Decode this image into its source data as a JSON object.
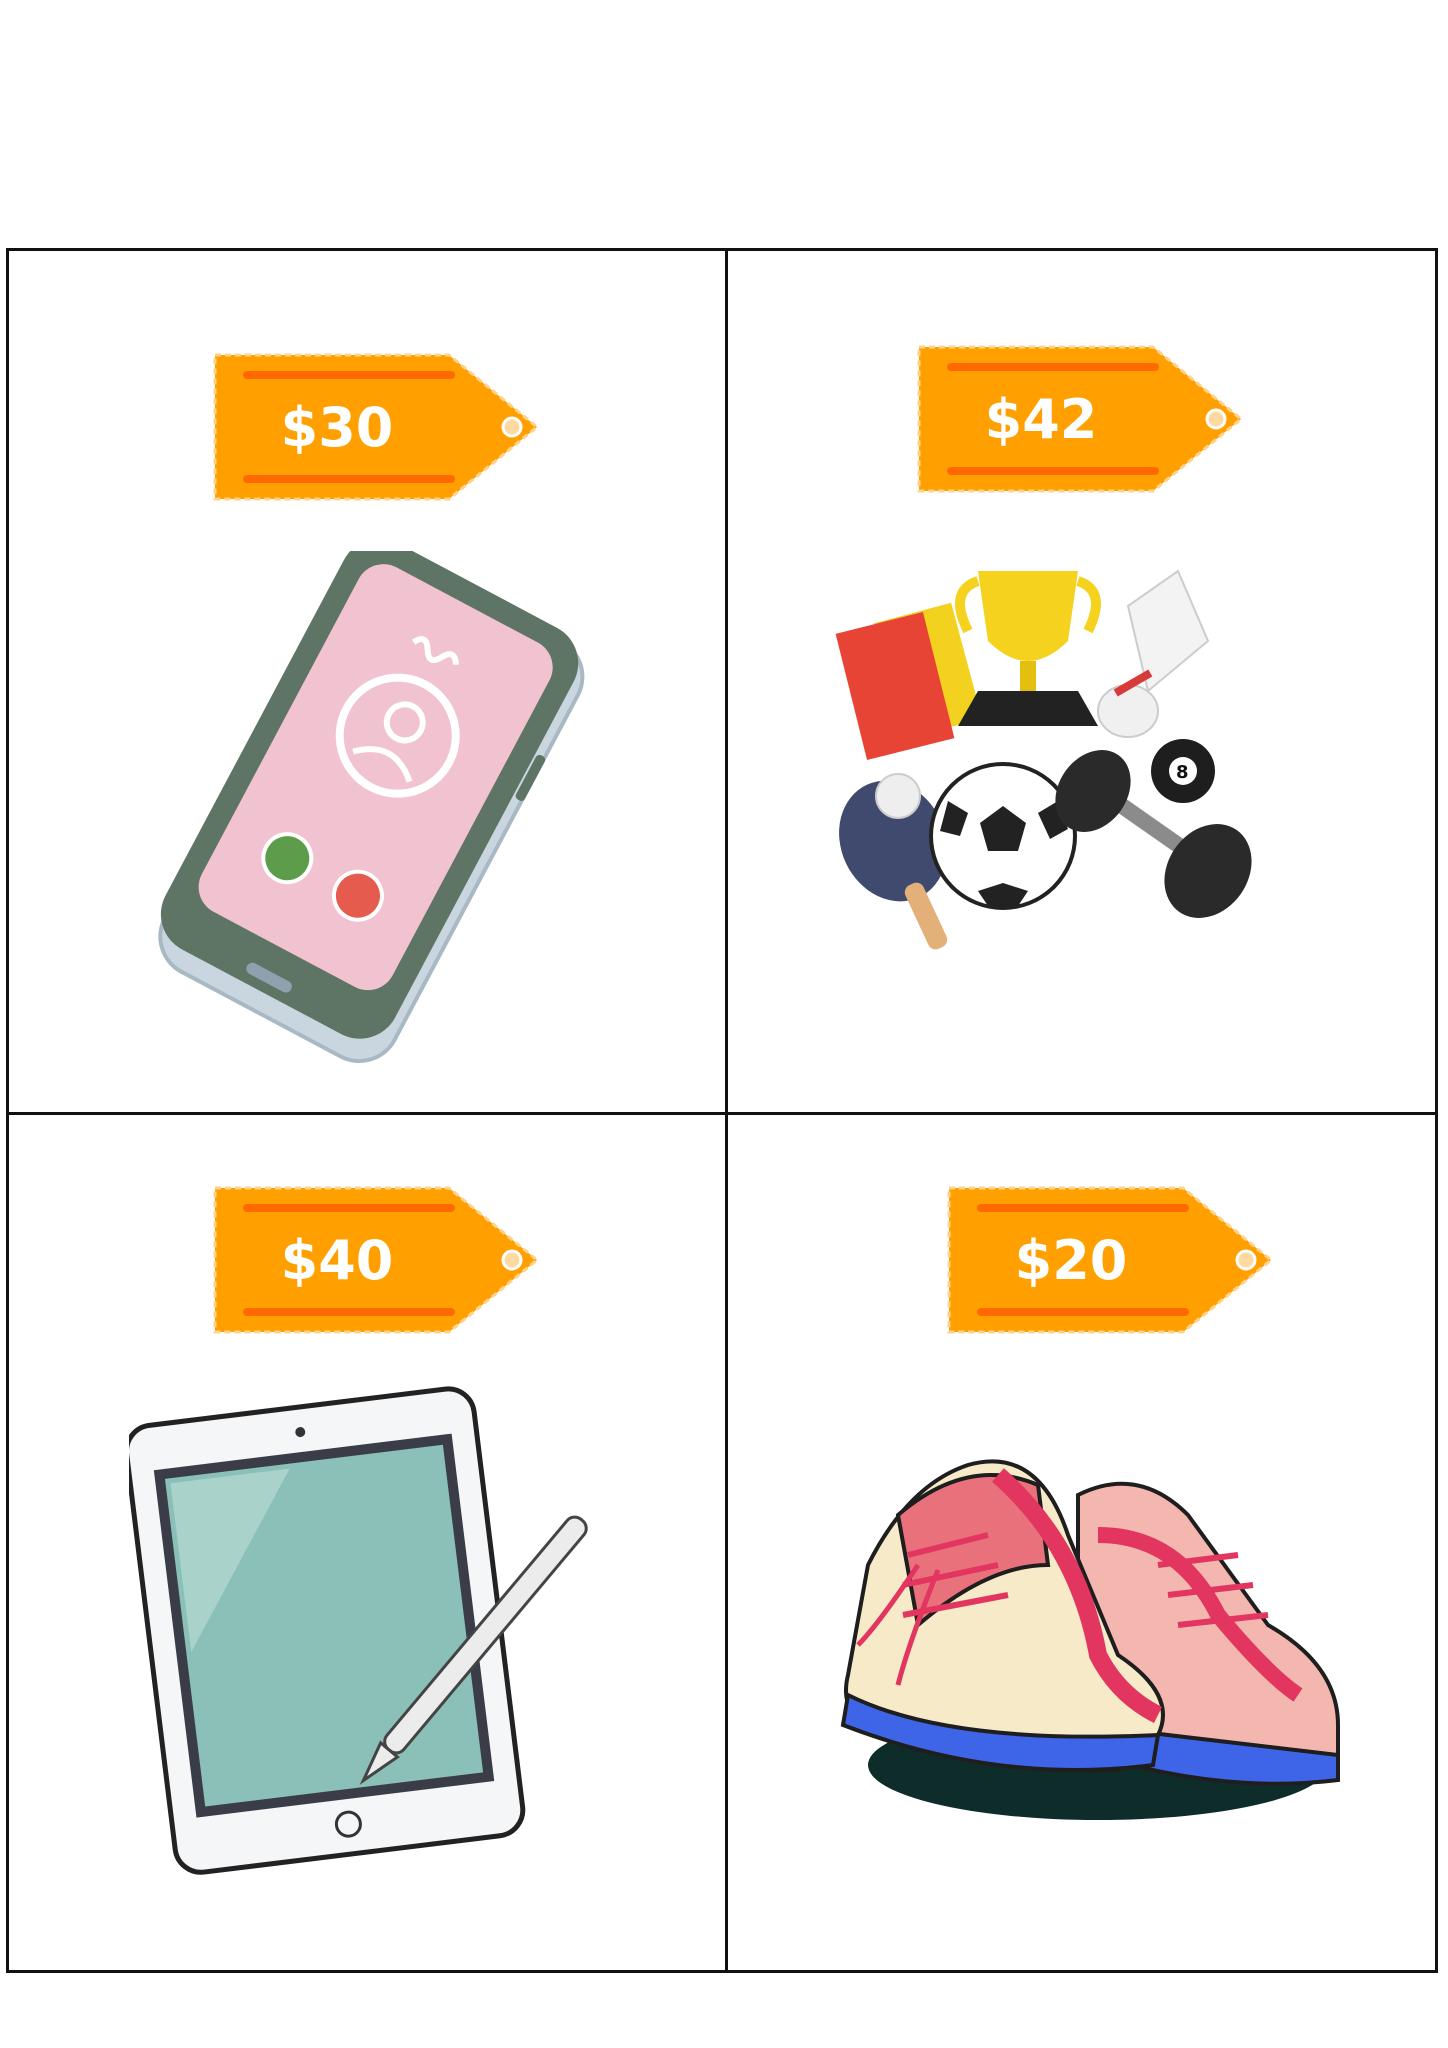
{
  "cards": [
    {
      "item": "smartphone",
      "price": "$30"
    },
    {
      "item": "sports-equipment",
      "price": "$42"
    },
    {
      "item": "tablet-with-stylus",
      "price": "$40"
    },
    {
      "item": "sneakers",
      "price": "$20"
    }
  ],
  "colors": {
    "tag": "#FFA000",
    "tag_stripe": "#FF6A00",
    "border": "#111111"
  }
}
